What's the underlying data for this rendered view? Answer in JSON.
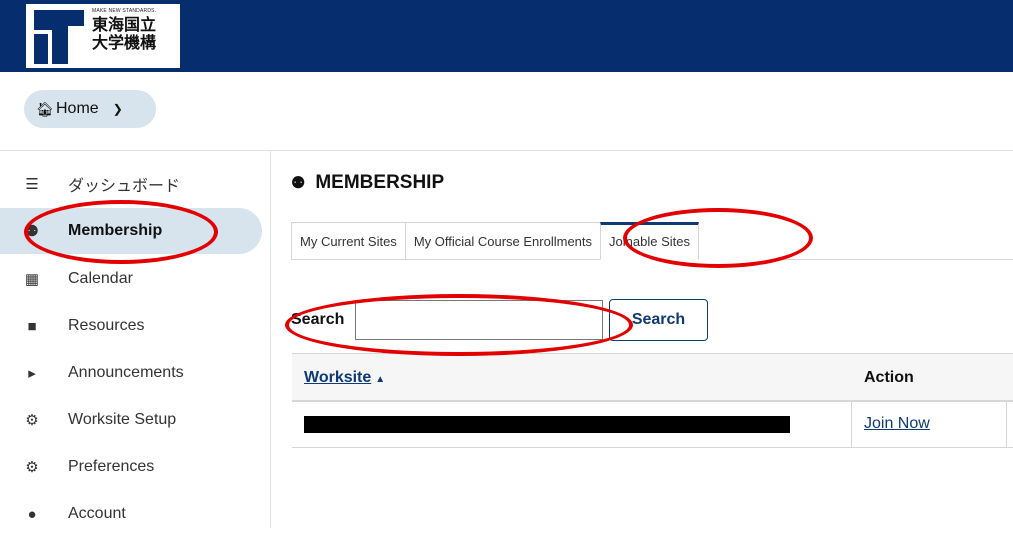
{
  "header": {
    "logo_tagline": "MAKE NEW STANDARDS.",
    "logo_name_line1": "東海国立",
    "logo_name_line2": "大学機構"
  },
  "site_switcher": {
    "icon": "home-icon",
    "label": "Home"
  },
  "sidebar": {
    "items": [
      {
        "label": "ダッシュボード",
        "icon": "list-icon",
        "active": false
      },
      {
        "label": "Membership",
        "icon": "users-icon",
        "active": true
      },
      {
        "label": "Calendar",
        "icon": "calendar-icon",
        "active": false
      },
      {
        "label": "Resources",
        "icon": "folder-icon",
        "active": false
      },
      {
        "label": "Announcements",
        "icon": "bullhorn-icon",
        "active": false
      },
      {
        "label": "Worksite Setup",
        "icon": "cogs-icon",
        "active": false
      },
      {
        "label": "Preferences",
        "icon": "gear-icon",
        "active": false
      },
      {
        "label": "Account",
        "icon": "user-icon",
        "active": false
      }
    ]
  },
  "main": {
    "title": "MEMBERSHIP",
    "tabs": [
      {
        "label": "My Current Sites",
        "active": false
      },
      {
        "label": "My Official Course Enrollments",
        "active": false
      },
      {
        "label": "Joinable Sites",
        "active": true
      }
    ],
    "search": {
      "label": "Search",
      "value": "",
      "button": "Search"
    },
    "table": {
      "headers": {
        "worksite": "Worksite",
        "sort_indicator": "▲",
        "action": "Action"
      },
      "rows": [
        {
          "worksite": "",
          "action": "Join Now"
        }
      ]
    }
  },
  "colors": {
    "header_bg": "#062d6e",
    "accent": "#0e3a75",
    "active_bg": "#d7e4ed",
    "annotation": "#e30000"
  }
}
